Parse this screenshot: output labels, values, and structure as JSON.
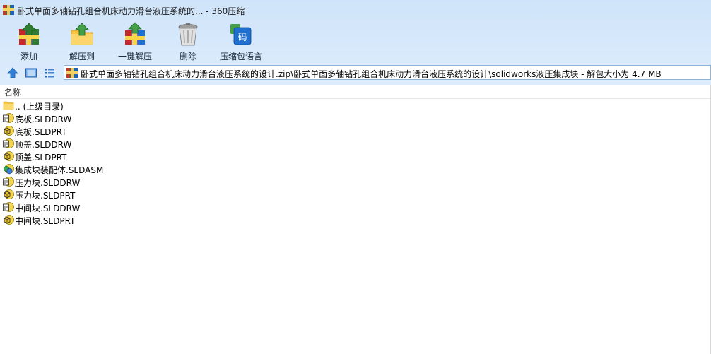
{
  "window": {
    "title": "卧式单面多轴钻孔组合机床动力滑台液压系统的... - 360压缩"
  },
  "toolbar": {
    "buttons": [
      {
        "label": "添加",
        "icon": "add-icon"
      },
      {
        "label": "解压到",
        "icon": "extract-to-icon"
      },
      {
        "label": "一键解压",
        "icon": "one-click-extract-icon"
      },
      {
        "label": "删除",
        "icon": "delete-icon"
      },
      {
        "label": "压缩包语言",
        "icon": "archive-language-icon",
        "icon_text": "码"
      }
    ]
  },
  "address": {
    "path": "卧式单面多轴钻孔组合机床动力滑台液压系统的设计.zip\\卧式单面多轴钻孔组合机床动力滑台液压系统的设计\\solidworks液压集成块 - 解包大小为 4.7 MB"
  },
  "list": {
    "column_name": "名称",
    "items": [
      {
        "name": ".. (上级目录)",
        "icon": "folder-icon"
      },
      {
        "name": "底板.SLDDRW",
        "icon": "sldprt-drawing-icon"
      },
      {
        "name": "底板.SLDPRT",
        "icon": "sldprt-part-icon"
      },
      {
        "name": "顶盖.SLDDRW",
        "icon": "sldprt-drawing-icon"
      },
      {
        "name": "顶盖.SLDPRT",
        "icon": "sldprt-part-icon"
      },
      {
        "name": "集成块装配体.SLDASM",
        "icon": "sldasm-assembly-icon"
      },
      {
        "name": "压力块.SLDDRW",
        "icon": "sldprt-drawing-icon"
      },
      {
        "name": "压力块.SLDPRT",
        "icon": "sldprt-part-icon"
      },
      {
        "name": "中间块.SLDDRW",
        "icon": "sldprt-drawing-icon"
      },
      {
        "name": "中间块.SLDPRT",
        "icon": "sldprt-part-icon"
      }
    ]
  }
}
